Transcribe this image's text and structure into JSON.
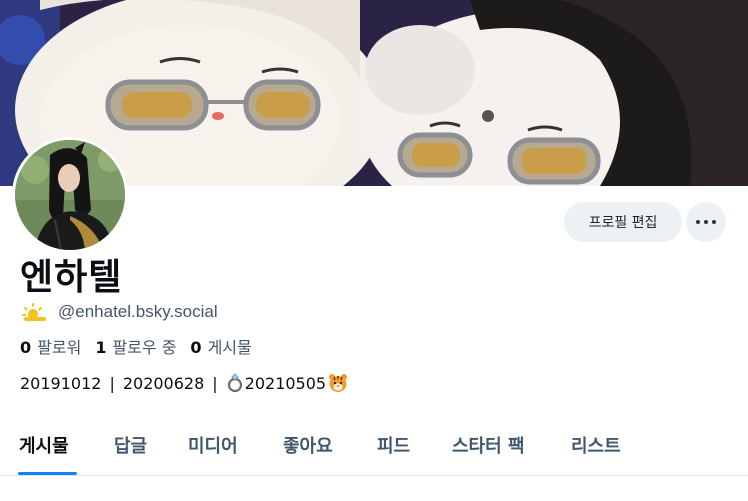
{
  "header": {
    "edit_profile_label": "프로필 편집"
  },
  "profile": {
    "display_name": "엔하텔",
    "handle": "@enhatel.bsky.social",
    "handle_prefix_icon": "sun-behind-cloud-icon"
  },
  "stats": {
    "followers_count": "0",
    "followers_label": "팔로워",
    "following_count": "1",
    "following_label": "팔로우 중",
    "posts_count": "0",
    "posts_label": "게시물"
  },
  "bio": {
    "part1": "20191012",
    "part2": "20200628",
    "part3": "20210505",
    "separator": "|",
    "icons": [
      "ring-icon",
      "tiger-icon"
    ]
  },
  "tabs": [
    {
      "label": "게시물",
      "active": true
    },
    {
      "label": "답글",
      "active": false
    },
    {
      "label": "미디어",
      "active": false
    },
    {
      "label": "좋아요",
      "active": false
    },
    {
      "label": "피드",
      "active": false
    },
    {
      "label": "스타터 팩",
      "active": false
    },
    {
      "label": "리스트",
      "active": false
    }
  ],
  "colors": {
    "accent": "#1083fe",
    "secondary_text": "#42576c",
    "button_bg": "#eef1f4"
  }
}
